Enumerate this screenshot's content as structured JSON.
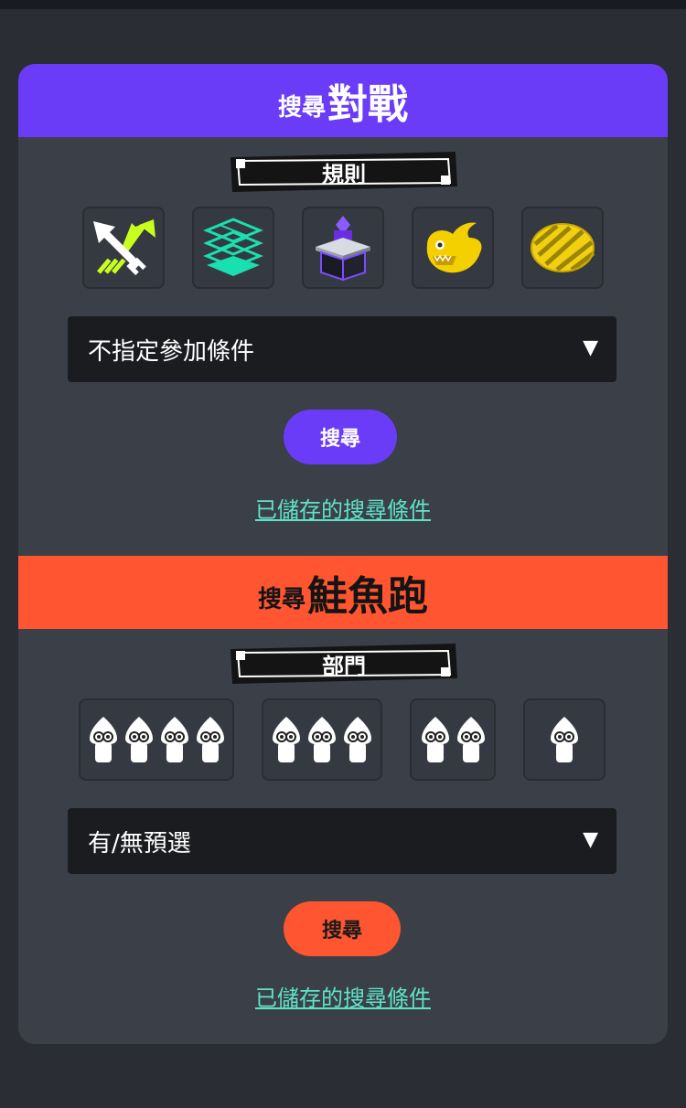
{
  "battle": {
    "header_small": "搜尋",
    "header_big": "對戰",
    "rules_label": "規則",
    "rules": [
      {
        "name": "turf-war-icon"
      },
      {
        "name": "splat-zones-icon"
      },
      {
        "name": "tower-control-icon"
      },
      {
        "name": "rainmaker-icon"
      },
      {
        "name": "clam-blitz-icon"
      }
    ],
    "select_value": "不指定參加條件",
    "search_label": "搜尋",
    "saved_link": "已儲存的搜尋條件"
  },
  "salmon": {
    "header_small": "搜尋",
    "header_big": "鮭魚跑",
    "mode_label": "部門",
    "modes": [
      {
        "name": "four-players",
        "count": 4
      },
      {
        "name": "three-players",
        "count": 3
      },
      {
        "name": "two-players",
        "count": 2
      },
      {
        "name": "one-player",
        "count": 1
      }
    ],
    "select_value": "有/無預選",
    "search_label": "搜尋",
    "saved_link": "已儲存的搜尋條件"
  },
  "colors": {
    "battle_accent": "#6b3cf7",
    "salmon_accent": "#ff5530",
    "link": "#5fe3c8",
    "card_bg": "#3b3f48",
    "page_bg": "#2b2d34"
  }
}
